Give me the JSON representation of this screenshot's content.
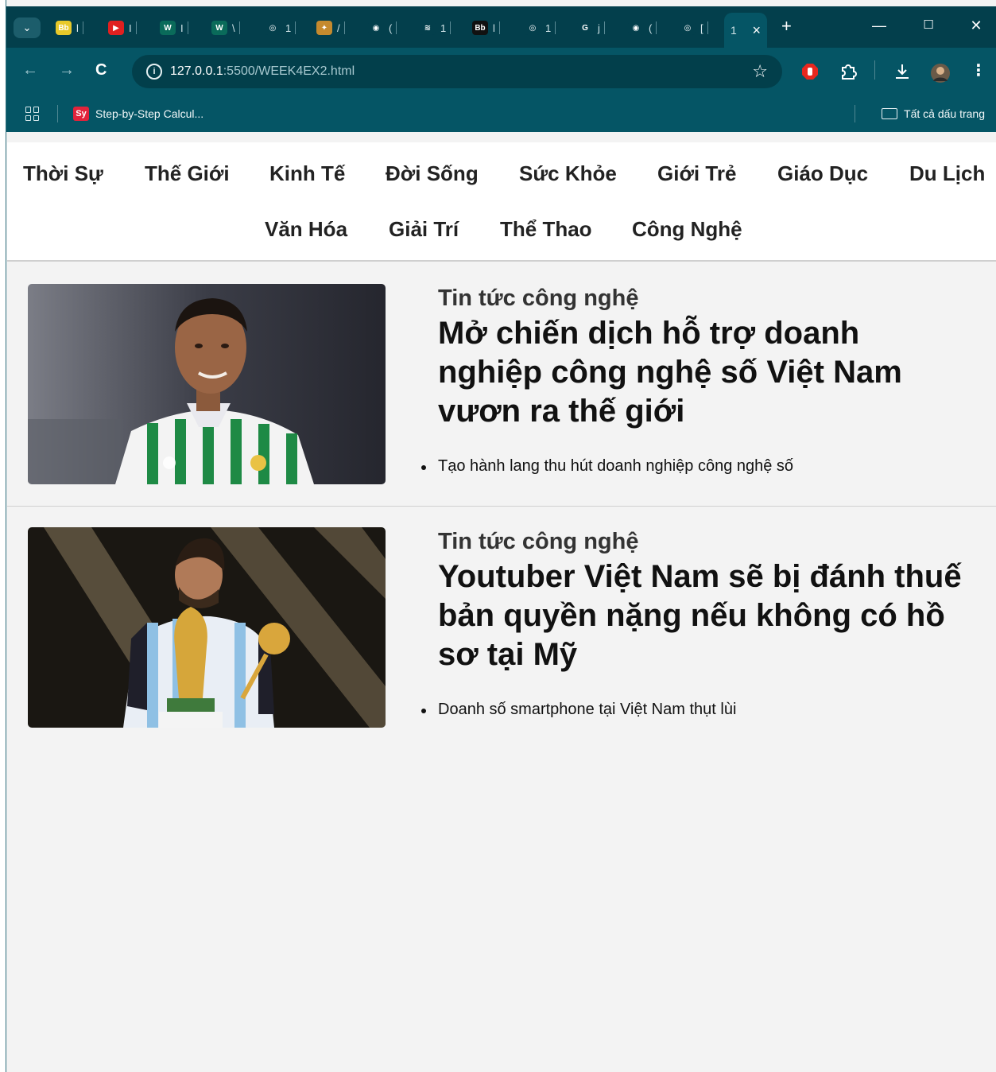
{
  "browser": {
    "tabs": [
      {
        "fav_text": "Bb",
        "title": "l",
        "fav_color": "#e8c92a"
      },
      {
        "fav_text": "▶",
        "title": "I",
        "fav_color": "#e02020"
      },
      {
        "fav_text": "W",
        "title": "I",
        "fav_color": "#0a6b5a"
      },
      {
        "fav_text": "W",
        "title": "\\",
        "fav_color": "#0a6b5a"
      },
      {
        "fav_text": "◎",
        "title": "1",
        "fav_color": "#033f4c"
      },
      {
        "fav_text": "✦",
        "title": "/",
        "fav_color": "#c58a2e"
      },
      {
        "fav_text": "◉",
        "title": "(",
        "fav_color": "#033f4c"
      },
      {
        "fav_text": "≋",
        "title": "1",
        "fav_color": "#033f4c"
      },
      {
        "fav_text": "Bb",
        "title": "l",
        "fav_color": "#111111"
      },
      {
        "fav_text": "◎",
        "title": "1",
        "fav_color": "#033f4c"
      },
      {
        "fav_text": "G",
        "title": "j",
        "fav_color": "#033f4c"
      },
      {
        "fav_text": "◉",
        "title": "(",
        "fav_color": "#033f4c"
      },
      {
        "fav_text": "◎",
        "title": "[",
        "fav_color": "#033f4c"
      }
    ],
    "active_tab": {
      "title": "1",
      "close": "×"
    },
    "new_tab": "+",
    "window_controls": {
      "minimize": "—",
      "maximize": "☐",
      "close": "✕"
    },
    "url": {
      "host": "127.0.0.1",
      "path": ":5500/WEEK4EX2.html"
    },
    "bookmarks": [
      {
        "fav_text": "Sy",
        "label": "Step-by-Step Calcul..."
      }
    ],
    "all_bookmarks": "Tất cả dấu trang"
  },
  "nav": {
    "row1": [
      "Thời Sự",
      "Thế Giới",
      "Kinh Tế",
      "Đời Sống",
      "Sức Khỏe",
      "Giới Trẻ",
      "Giáo Dục",
      "Du Lịch"
    ],
    "row2": [
      "Văn Hóa",
      "Giải Trí",
      "Thể Thao",
      "Công Nghệ"
    ]
  },
  "articles": [
    {
      "category": "Tin tức công nghệ",
      "headline": "Mở chiến dịch hỗ trợ doanh nghiệp công nghệ số Việt Nam vươn ra thế giới",
      "bullets": [
        "Tạo hành lang thu hút doanh nghiệp công nghệ số"
      ]
    },
    {
      "category": "Tin tức công nghệ",
      "headline": "Youtuber Việt Nam sẽ bị đánh thuế bản quyền nặng nếu không có hồ sơ tại Mỹ",
      "bullets": [
        "Doanh số smartphone tại Việt Nam thụt lùi"
      ]
    }
  ]
}
